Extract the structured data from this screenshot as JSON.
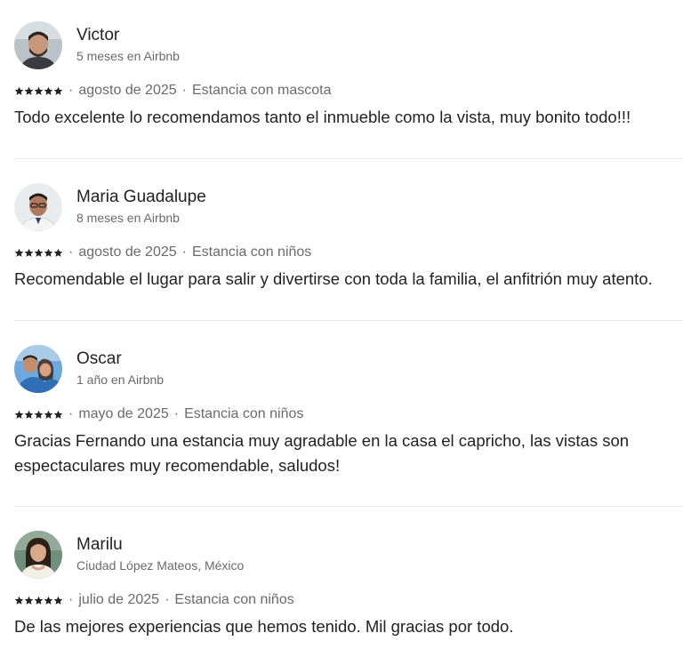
{
  "reviews": [
    {
      "name": "Victor",
      "subtitle": "5 meses en Airbnb",
      "rating": 5,
      "date": "agosto de 2025",
      "separator": "·",
      "stay_type": "Estancia con mascota",
      "text": "Todo excelente lo recomendamos tanto el inmueble como la vista, muy bonito todo!!!",
      "avatar_icon": "avatar-photo-man-beard"
    },
    {
      "name": "Maria Guadalupe",
      "subtitle": "8 meses en Airbnb",
      "rating": 5,
      "date": "agosto de 2025",
      "separator": "·",
      "stay_type": "Estancia con niños",
      "text": "Recomendable el lugar para  salir y divertirse con toda la familia, el anfitrión muy atento.",
      "avatar_icon": "avatar-photo-man-glasses"
    },
    {
      "name": "Oscar",
      "subtitle": "1 año en Airbnb",
      "rating": 5,
      "date": "mayo de 2025",
      "separator": "·",
      "stay_type": "Estancia con niños",
      "text": "Gracias Fernando una estancia muy agradable en la casa el capricho, las vistas son espectaculares muy recomendable, saludos!",
      "avatar_icon": "avatar-photo-couple"
    },
    {
      "name": "Marilu",
      "subtitle": "Ciudad López Mateos, México",
      "rating": 5,
      "date": "julio de 2025",
      "separator": "·",
      "stay_type": "Estancia con niños",
      "text": "De las mejores experiencias que hemos tenido. Mil gracias por todo.",
      "avatar_icon": "avatar-photo-woman"
    }
  ],
  "colors": {
    "text_primary": "#222222",
    "text_secondary": "#6a6a6a",
    "divider": "#e6e6e6",
    "star": "#222222"
  }
}
